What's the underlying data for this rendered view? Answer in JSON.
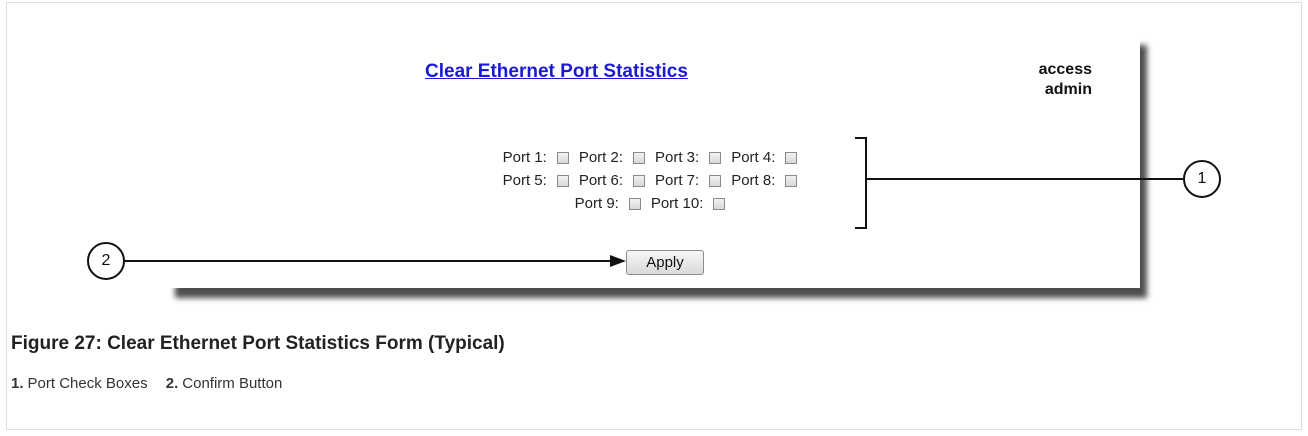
{
  "form": {
    "title": "Clear Ethernet Port Statistics",
    "user_line1": "access",
    "user_line2": "admin",
    "ports": [
      [
        "Port 1:",
        "Port 2:",
        "Port 3:",
        "Port 4:"
      ],
      [
        "Port 5:",
        "Port 6:",
        "Port 7:",
        "Port 8:"
      ],
      [
        "Port 9:",
        "Port 10:"
      ]
    ],
    "apply_label": "Apply"
  },
  "callouts": {
    "one": "1",
    "two": "2"
  },
  "figure": {
    "caption": "Figure 27: Clear Ethernet Port Statistics Form (Typical)",
    "legend_1_num": "1.",
    "legend_1_text": "Port Check Boxes",
    "legend_2_num": "2.",
    "legend_2_text": "Confirm Button"
  }
}
